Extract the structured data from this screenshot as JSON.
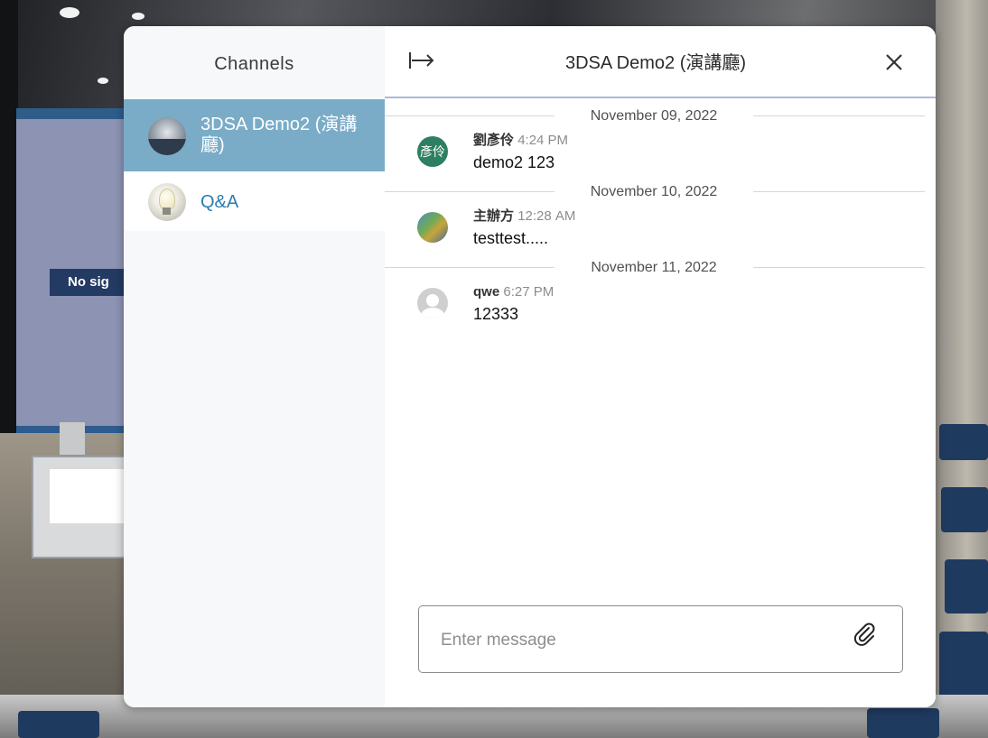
{
  "scene": {
    "screen_text": "No sig"
  },
  "sidebar": {
    "title": "Channels",
    "channels": [
      {
        "name": "3DSA Demo2 (演講廳)",
        "active": true,
        "icon": "auditorium-thumbnail"
      },
      {
        "name": "Q&A",
        "active": false,
        "icon": "lightbulb-icon"
      }
    ]
  },
  "header": {
    "title": "3DSA Demo2 (演講廳)",
    "collapse_icon": "collapse-right-icon",
    "close_icon": "close-icon"
  },
  "messages": [
    {
      "date": "November 09, 2022",
      "author": "劉彥伶",
      "time": "4:24 PM",
      "text": "demo2 123",
      "avatar_text": "彥伶",
      "avatar_color": "#2e7f62"
    },
    {
      "date": "November 10, 2022",
      "author": "主辦方",
      "time": "12:28 AM",
      "text": "testtest.....",
      "avatar_text": "",
      "avatar_color": "#4f8fbf"
    },
    {
      "date": "November 11, 2022",
      "author": "qwe",
      "time": "6:27 PM",
      "text": "12333",
      "avatar_text": "",
      "avatar_color": "#cfcfcf"
    }
  ],
  "composer": {
    "placeholder": "Enter message",
    "value": "",
    "attach_icon": "paperclip-icon"
  },
  "colors": {
    "active_channel_bg": "#7aacc8",
    "link_blue": "#2b7db1",
    "header_divider": "#aeb9d6"
  }
}
